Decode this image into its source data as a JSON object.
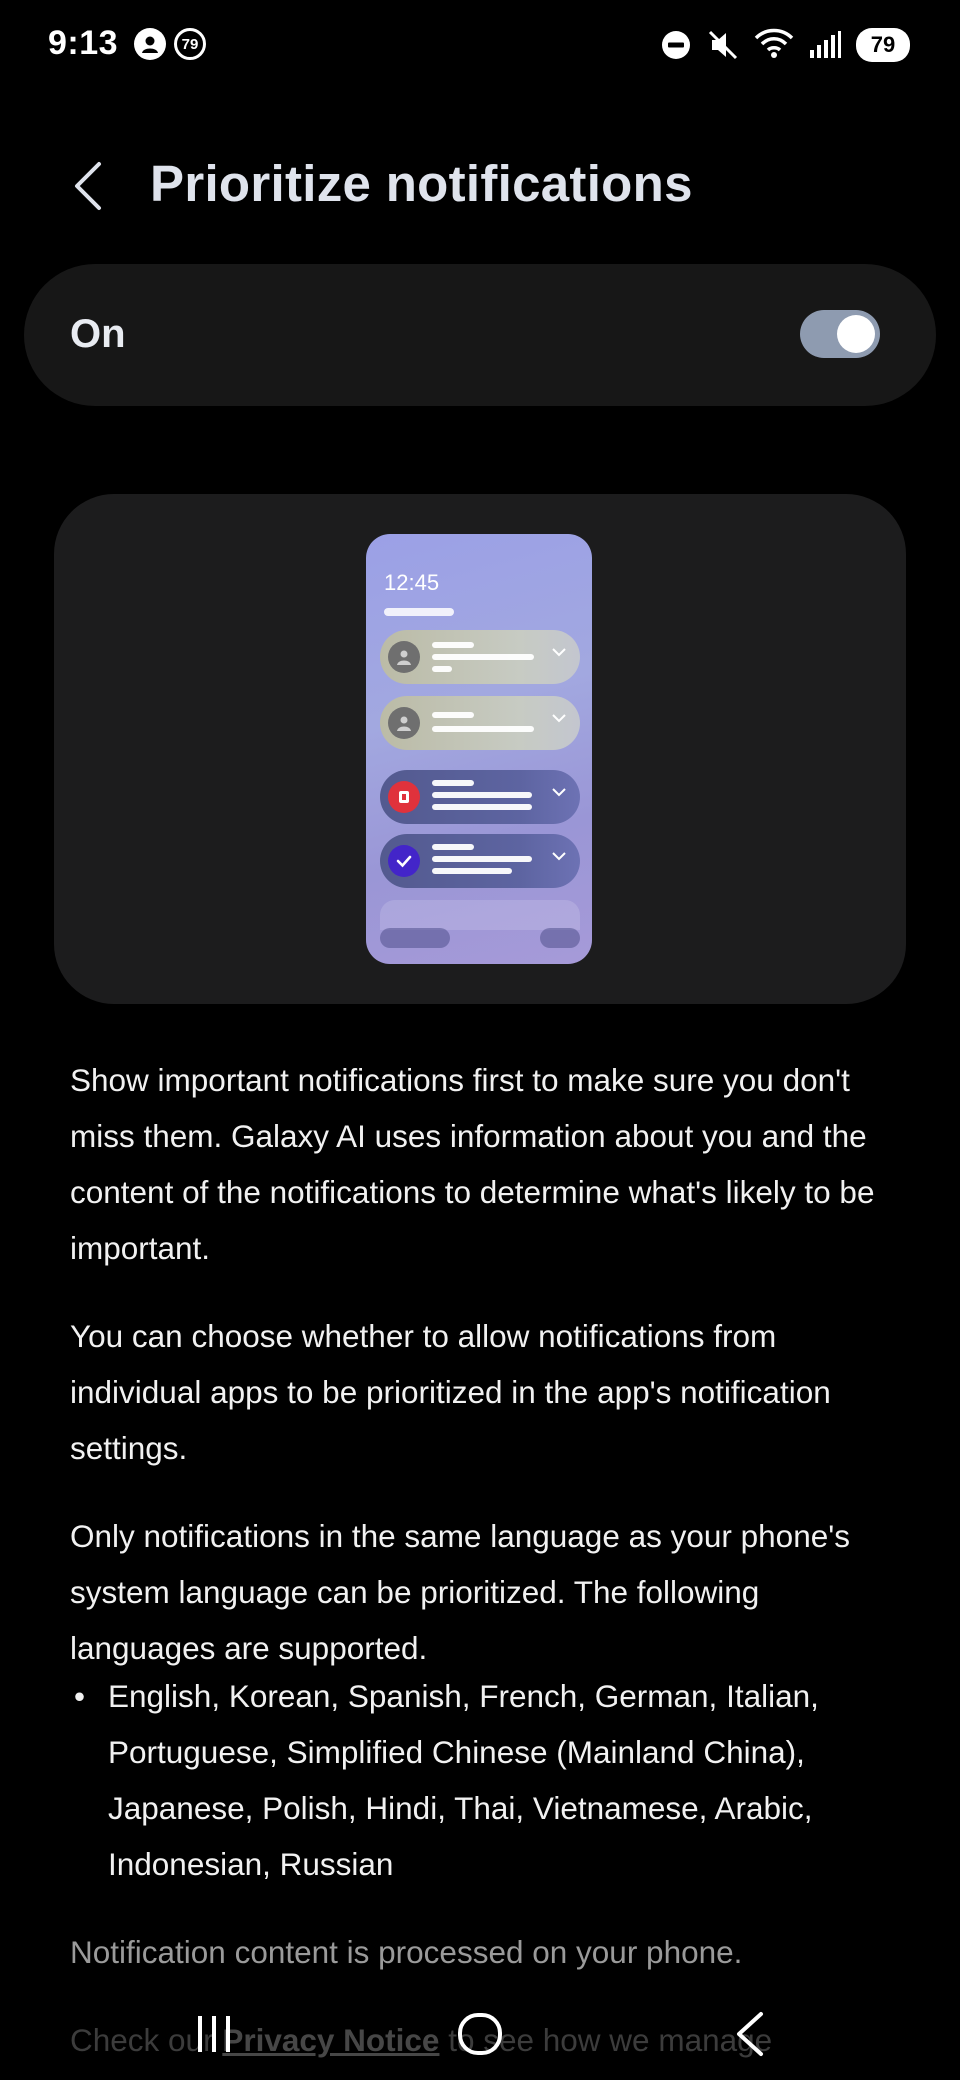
{
  "status_bar": {
    "time": "9:13",
    "notif_count": "79",
    "wifi_band": "5",
    "battery": "79"
  },
  "header": {
    "title": "Prioritize notifications"
  },
  "toggle": {
    "label": "On",
    "state": true
  },
  "illustration": {
    "time": "12:45"
  },
  "description": {
    "p1": "Show important notifications first to make sure you don't miss them. Galaxy AI uses information about you and the content of the notifications to determine what's likely to be important.",
    "p2": "You can choose whether to allow notifications from individual apps to be prioritized in the app's notification settings.",
    "p3": "Only notifications in the same language as your phone's system language can be prioritized. The following languages are supported.",
    "languages": "English, Korean, Spanish, French, German, Italian, Portuguese, Simplified Chinese (Mainland China), Japanese, Polish, Hindi, Thai, Vietnamese, Arabic, Indonesian, Russian",
    "processing_note": "Notification content is processed on your phone.",
    "privacy_prefix": "Check our ",
    "privacy_link": "Privacy Notice",
    "privacy_suffix": " to see how we manage"
  },
  "nav": {
    "recents_icon": "recents-icon",
    "home_icon": "home-icon",
    "back_icon": "back-icon"
  },
  "colors": {
    "background": "#000000",
    "card": "#171717",
    "switch_track": "#8e9bb0",
    "title": "#dfe3ec"
  }
}
